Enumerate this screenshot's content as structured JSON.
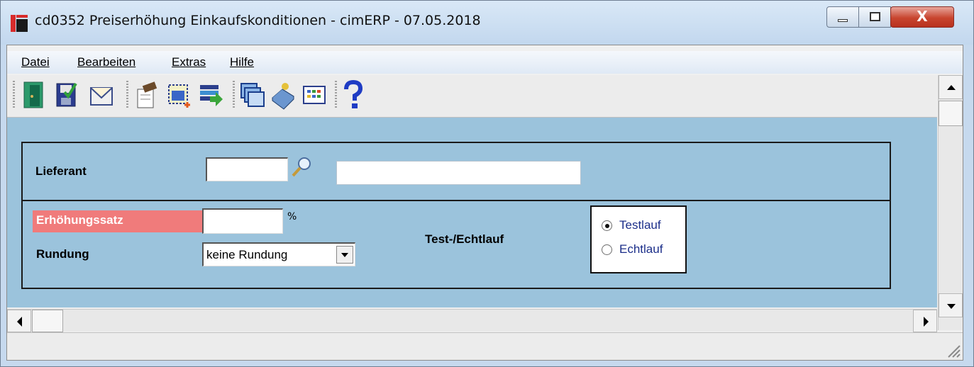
{
  "window": {
    "title": "cd0352 Preiserhöhung Einkaufskonditionen - cimERP - 07.05.2018",
    "close_glyph": "X"
  },
  "menu": {
    "items": [
      {
        "label": "Datei"
      },
      {
        "label": "Bearbeiten"
      },
      {
        "label": "Extras"
      },
      {
        "label": "Hilfe"
      }
    ]
  },
  "toolbar": {
    "icons": [
      "exit-door-icon",
      "save-icon",
      "mail-icon",
      "edit-properties-icon",
      "new-selection-icon",
      "import-list-icon",
      "windows-cascade-icon",
      "book-icon",
      "grid-view-icon",
      "help-icon"
    ]
  },
  "form": {
    "lieferant_label": "Lieferant",
    "lieferant_value": "",
    "lieferant_name": "",
    "erhoehung_label": "Erhöhungssatz",
    "erhoehung_value": "",
    "percent_sign": "%",
    "rundung_label": "Rundung",
    "rundung_value": "keine Rundung",
    "testlauf_label": "Test-/Echtlauf",
    "radio_testlauf": "Testlauf",
    "radio_echtlauf": "Echtlauf",
    "selected_mode": "Testlauf"
  },
  "colors": {
    "content_bg": "#9bc3dc",
    "erhoehung_bg": "#f07b7b",
    "radio_text": "#1c2f8a"
  }
}
